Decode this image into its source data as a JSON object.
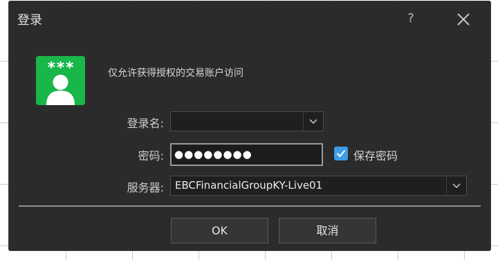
{
  "dialog": {
    "title": "登录",
    "help_label": "?",
    "banner_text": "仅允许获得授权的交易账户访问",
    "icon_stars": "***"
  },
  "form": {
    "login_label": "登录名:",
    "login_value": "",
    "password_label": "密码:",
    "password_value": "●●●●●●●●",
    "save_password_label": "保存密码",
    "save_password_checked": true,
    "server_label": "服务器:",
    "server_value": "EBCFinancialGroupKY-Live01"
  },
  "buttons": {
    "ok": "OK",
    "cancel": "取消"
  },
  "colors": {
    "dialog_bg": "#2b2b2b",
    "icon_green": "#19b64a",
    "checkbox_blue": "#3d9de8"
  },
  "icons": {
    "help": "question-mark-icon",
    "close": "close-icon",
    "dropdown": "chevron-down-icon",
    "user": "user-icon",
    "check": "check-icon"
  }
}
